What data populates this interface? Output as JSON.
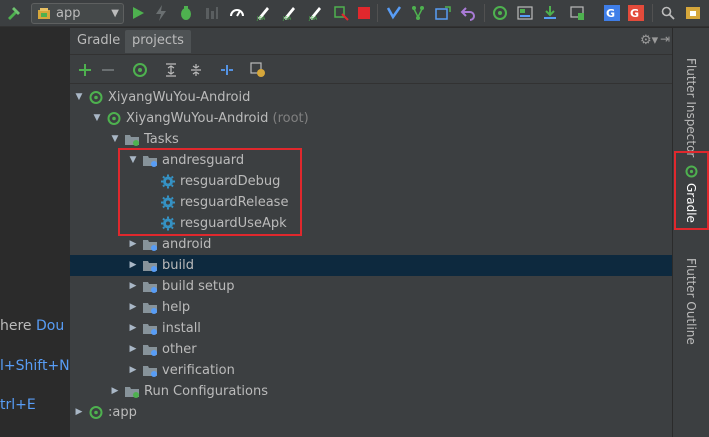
{
  "toolbar": {
    "run_config": "app",
    "icons": [
      "hammer-icon",
      "run-icon",
      "debug-icon",
      "attach-debugger-icon",
      "profile-icon",
      "flutter-hot-reload-icon",
      "jira-icon",
      "jira-icon",
      "jira-icon",
      "stop-device-icon",
      "stop-icon",
      "merge-icon",
      "vcs-icon",
      "vcs-push-icon",
      "undo-icon",
      "sync-icon",
      "layout-icon",
      "sdk-manager-icon",
      "device-icon",
      "translate-icon",
      "translate-icon",
      "search-icon",
      "android-icon"
    ]
  },
  "editor_hints": {
    "line1_text": "here ",
    "line1_key": "Dou",
    "line2_key": "l+Shift+N",
    "line3_key": "trl+E"
  },
  "panel": {
    "title": "Gradle",
    "tab": "projects"
  },
  "tree": [
    {
      "label": "XiyangWuYou-Android",
      "suffix": "",
      "level": 0,
      "expanded": true,
      "icon": "gradle-project-icon"
    },
    {
      "label": "XiyangWuYou-Android",
      "suffix": "(root)",
      "level": 1,
      "expanded": true,
      "icon": "gradle-project-icon"
    },
    {
      "label": "Tasks",
      "suffix": "",
      "level": 2,
      "expanded": true,
      "icon": "folder-icon"
    },
    {
      "label": "andresguard",
      "suffix": "",
      "level": 3,
      "expanded": true,
      "icon": "task-folder-icon"
    },
    {
      "label": "resguardDebug",
      "suffix": "",
      "level": 4,
      "icon": "gear-icon"
    },
    {
      "label": "resguardRelease",
      "suffix": "",
      "level": 4,
      "icon": "gear-icon"
    },
    {
      "label": "resguardUseApk",
      "suffix": "",
      "level": 4,
      "icon": "gear-icon"
    },
    {
      "label": "android",
      "suffix": "",
      "level": 3,
      "expanded": false,
      "icon": "task-folder-icon"
    },
    {
      "label": "build",
      "suffix": "",
      "level": 3,
      "expanded": false,
      "icon": "task-folder-icon",
      "selected": true
    },
    {
      "label": "build setup",
      "suffix": "",
      "level": 3,
      "expanded": false,
      "icon": "task-folder-icon"
    },
    {
      "label": "help",
      "suffix": "",
      "level": 3,
      "expanded": false,
      "icon": "task-folder-icon"
    },
    {
      "label": "install",
      "suffix": "",
      "level": 3,
      "expanded": false,
      "icon": "task-folder-icon"
    },
    {
      "label": "other",
      "suffix": "",
      "level": 3,
      "expanded": false,
      "icon": "task-folder-icon"
    },
    {
      "label": "verification",
      "suffix": "",
      "level": 3,
      "expanded": false,
      "icon": "task-folder-icon"
    },
    {
      "label": "Run Configurations",
      "suffix": "",
      "level": 2,
      "expanded": false,
      "icon": "folder-icon"
    },
    {
      "label": ":app",
      "suffix": "",
      "level": 0,
      "expanded": false,
      "icon": "gradle-module-icon"
    }
  ],
  "right_strip": {
    "tab1": "Flutter Inspector",
    "tab2": "Gradle",
    "tab3": "Flutter Outline"
  },
  "colors": {
    "accent_green": "#4eb14f",
    "highlight_red": "#e0282d",
    "selection": "#0d293e",
    "link_blue": "#589df6"
  }
}
